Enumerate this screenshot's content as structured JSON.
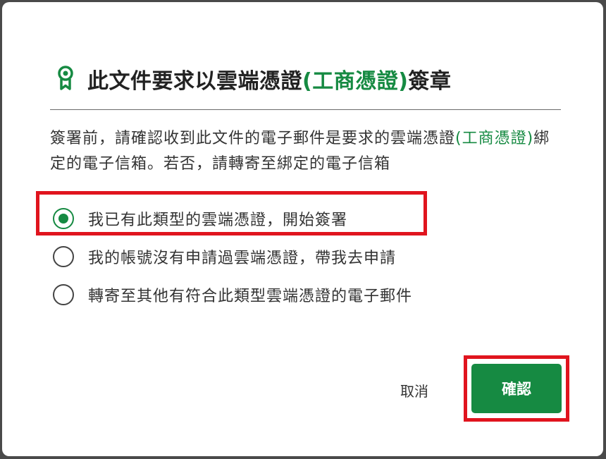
{
  "dialog": {
    "title_prefix": "此文件要求以雲端憑證",
    "title_accent": "(工商憑證)",
    "title_suffix": "簽章",
    "notice_prefix": "簽署前，請確認收到此文件的電子郵件是要求的雲端憑證",
    "notice_accent": "(工商憑證)",
    "notice_suffix": "綁定的電子信箱。若否，請轉寄至綁定的電子信箱",
    "options": [
      {
        "label": "我已有此類型的雲端憑證，開始簽署",
        "checked": true
      },
      {
        "label": "我的帳號沒有申請過雲端憑證，帶我去申請",
        "checked": false
      },
      {
        "label": "轉寄至其他有符合此類型雲端憑證的電子郵件",
        "checked": false
      }
    ],
    "cancel_label": "取消",
    "confirm_label": "確認"
  },
  "colors": {
    "accent": "#168a42",
    "highlight": "#e0141e",
    "text": "#333333"
  },
  "icons": {
    "title_icon": "certificate-badge-icon"
  }
}
